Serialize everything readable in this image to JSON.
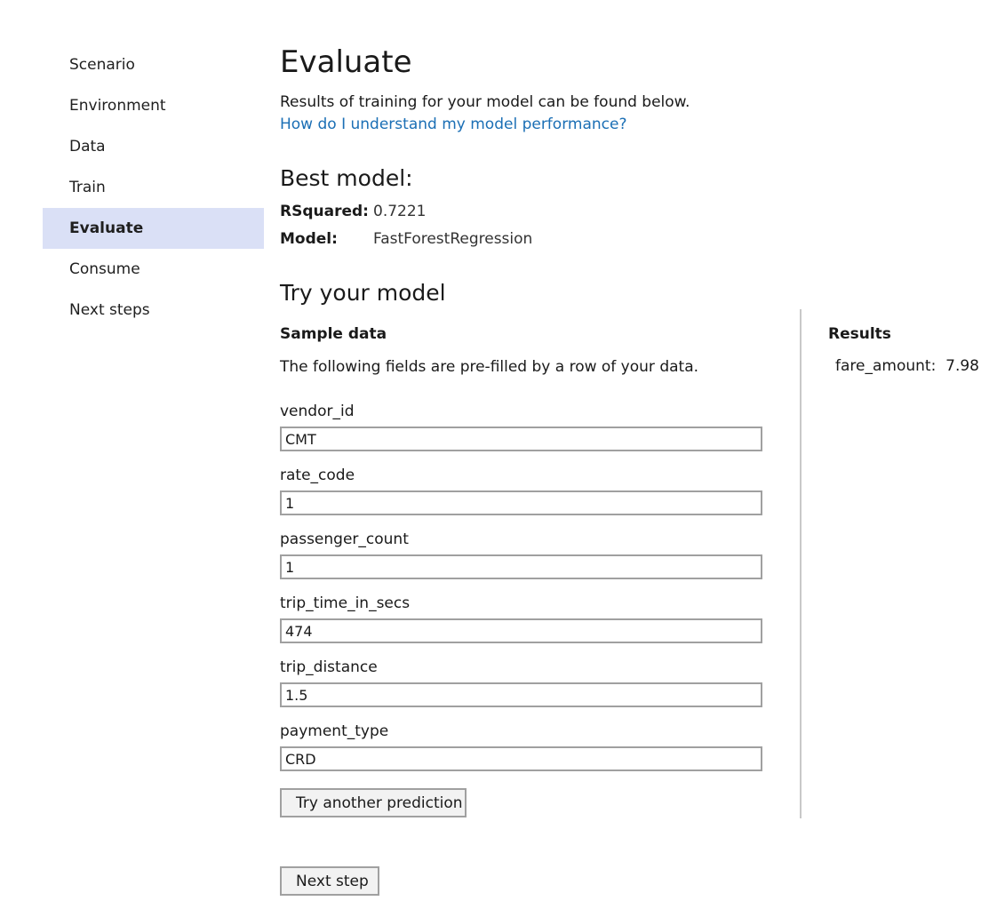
{
  "sidebar": {
    "items": [
      {
        "label": "Scenario",
        "active": false
      },
      {
        "label": "Environment",
        "active": false
      },
      {
        "label": "Data",
        "active": false
      },
      {
        "label": "Train",
        "active": false
      },
      {
        "label": "Evaluate",
        "active": true
      },
      {
        "label": "Consume",
        "active": false
      },
      {
        "label": "Next steps",
        "active": false
      }
    ]
  },
  "main": {
    "title": "Evaluate",
    "intro": "Results of training for your model can be found below.",
    "help_link": "How do I understand my model performance?",
    "best_model": {
      "heading": "Best model:",
      "rsquared_label": "RSquared:",
      "rsquared_value": "0.7221",
      "model_label": "Model:",
      "model_value": "FastForestRegression"
    },
    "try_model": {
      "heading": "Try your model",
      "sample_heading": "Sample data",
      "sample_description": "The following fields are pre-filled by a row of your data.",
      "fields": [
        {
          "label": "vendor_id",
          "value": "CMT"
        },
        {
          "label": "rate_code",
          "value": "1"
        },
        {
          "label": "passenger_count",
          "value": "1"
        },
        {
          "label": "trip_time_in_secs",
          "value": "474"
        },
        {
          "label": "trip_distance",
          "value": "1.5"
        },
        {
          "label": "payment_type",
          "value": "CRD"
        }
      ],
      "try_button": "Try another prediction"
    },
    "results": {
      "heading": "Results",
      "label": "fare_amount:",
      "value": "7.98"
    },
    "next_button": "Next step"
  },
  "colors": {
    "active_nav_bg": "#dae0f6",
    "link": "#1b6fb5",
    "divider": "#c8c8c8"
  }
}
